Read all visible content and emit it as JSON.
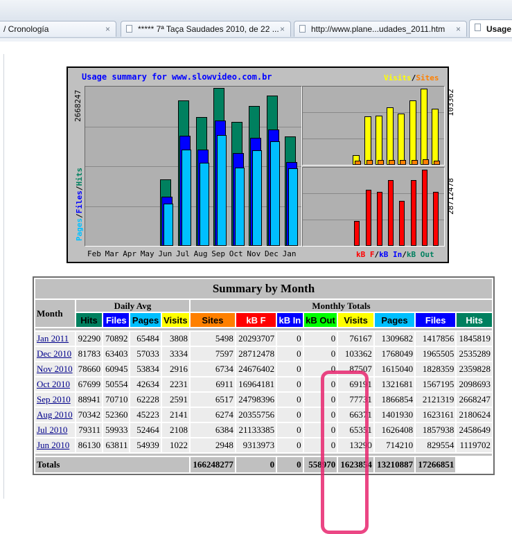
{
  "browser": {
    "tabs": [
      {
        "title": "/ Cronología",
        "close": "×"
      },
      {
        "title": "***** 7ª Taça Saudades 2010, de 22 ...",
        "close": "×"
      },
      {
        "title": "http://www.plane...udades_2011.htm",
        "close": "×"
      },
      {
        "title": "Usage",
        "close": ""
      }
    ]
  },
  "graph": {
    "title": "Usage summary for www.slowvideo.com.br",
    "legend_visits": "Visits",
    "legend_slash": "/",
    "legend_sites": "Sites",
    "y_left_max": "2668247",
    "y_right_top_max": "103362",
    "y_right_bottom_max": "28712478",
    "legend_pages": "Pages",
    "legend_files": "Files",
    "legend_hits": "Hits",
    "legend_kbf": "kB F",
    "legend_kbin": "kB In",
    "legend_kbout": "kB Out",
    "months": [
      "Feb",
      "Mar",
      "Apr",
      "May",
      "Jun",
      "Jul",
      "Aug",
      "Sep",
      "Oct",
      "Nov",
      "Dec",
      "Jan"
    ],
    "colors": {
      "hits": "#00805f",
      "files": "#0000ff",
      "pages": "#00bfff",
      "visits": "#ffff00",
      "sites": "#ff8000",
      "kbf": "#ff0000"
    }
  },
  "chart_data": {
    "type": "bar",
    "title": "Usage summary for www.slowvideo.com.br",
    "categories": [
      "Feb",
      "Mar",
      "Apr",
      "May",
      "Jun",
      "Jul",
      "Aug",
      "Sep",
      "Oct",
      "Nov",
      "Dec",
      "Jan"
    ],
    "series": [
      {
        "name": "Hits",
        "values": [
          0,
          0,
          0,
          0,
          1119702,
          2458649,
          2180624,
          2668247,
          2098693,
          2359828,
          2535289,
          1845819
        ]
      },
      {
        "name": "Files",
        "values": [
          0,
          0,
          0,
          0,
          829554,
          1857938,
          1623161,
          2121319,
          1567195,
          1828359,
          1965505,
          1417856
        ]
      },
      {
        "name": "Pages",
        "values": [
          0,
          0,
          0,
          0,
          714210,
          1626408,
          1401930,
          1866854,
          1321681,
          1615040,
          1768049,
          1309682
        ]
      },
      {
        "name": "Visits",
        "values": [
          0,
          0,
          0,
          0,
          13290,
          65351,
          66371,
          77731,
          69191,
          87507,
          103362,
          76167
        ]
      },
      {
        "name": "Sites",
        "values": [
          0,
          0,
          0,
          0,
          2948,
          6384,
          6274,
          6517,
          6911,
          6734,
          7597,
          5498
        ]
      },
      {
        "name": "kB F",
        "values": [
          0,
          0,
          0,
          0,
          9313973,
          21133385,
          20355756,
          24798396,
          16964181,
          24676402,
          28712478,
          20293707
        ]
      }
    ]
  },
  "table": {
    "title": "Summary by Month",
    "month_header": "Month",
    "daily_avg": "Daily Avg",
    "monthly_totals": "Monthly Totals",
    "columns": [
      "Hits",
      "Files",
      "Pages",
      "Visits",
      "Sites",
      "kB F",
      "kB In",
      "kB Out",
      "Visits",
      "Pages",
      "Files",
      "Hits"
    ],
    "rows": [
      {
        "month": "Jan 2011",
        "cells": [
          "92290",
          "70892",
          "65484",
          "3808",
          "5498",
          "20293707",
          "0",
          "0",
          "76167",
          "1309682",
          "1417856",
          "1845819"
        ]
      },
      {
        "month": "Dec 2010",
        "cells": [
          "81783",
          "63403",
          "57033",
          "3334",
          "7597",
          "28712478",
          "0",
          "0",
          "103362",
          "1768049",
          "1965505",
          "2535289"
        ]
      },
      {
        "month": "Nov 2010",
        "cells": [
          "78660",
          "60945",
          "53834",
          "2916",
          "6734",
          "24676402",
          "0",
          "0",
          "87507",
          "1615040",
          "1828359",
          "2359828"
        ]
      },
      {
        "month": "Oct 2010",
        "cells": [
          "67699",
          "50554",
          "42634",
          "2231",
          "6911",
          "16964181",
          "0",
          "0",
          "69191",
          "1321681",
          "1567195",
          "2098693"
        ]
      },
      {
        "month": "Sep 2010",
        "cells": [
          "88941",
          "70710",
          "62228",
          "2591",
          "6517",
          "24798396",
          "0",
          "0",
          "77731",
          "1866854",
          "2121319",
          "2668247"
        ]
      },
      {
        "month": "Aug 2010",
        "cells": [
          "70342",
          "52360",
          "45223",
          "2141",
          "6274",
          "20355756",
          "0",
          "0",
          "66371",
          "1401930",
          "1623161",
          "2180624"
        ]
      },
      {
        "month": "Jul 2010",
        "cells": [
          "79311",
          "59933",
          "52464",
          "2108",
          "6384",
          "21133385",
          "0",
          "0",
          "65351",
          "1626408",
          "1857938",
          "2458649"
        ]
      },
      {
        "month": "Jun 2010",
        "cells": [
          "86130",
          "63811",
          "54939",
          "1022",
          "2948",
          "9313973",
          "0",
          "0",
          "13290",
          "714210",
          "829554",
          "1119702"
        ]
      }
    ],
    "totals_label": "Totals",
    "totals": [
      "166248277",
      "0",
      "0",
      "558970",
      "1623854",
      "13210887",
      "17266851"
    ]
  }
}
